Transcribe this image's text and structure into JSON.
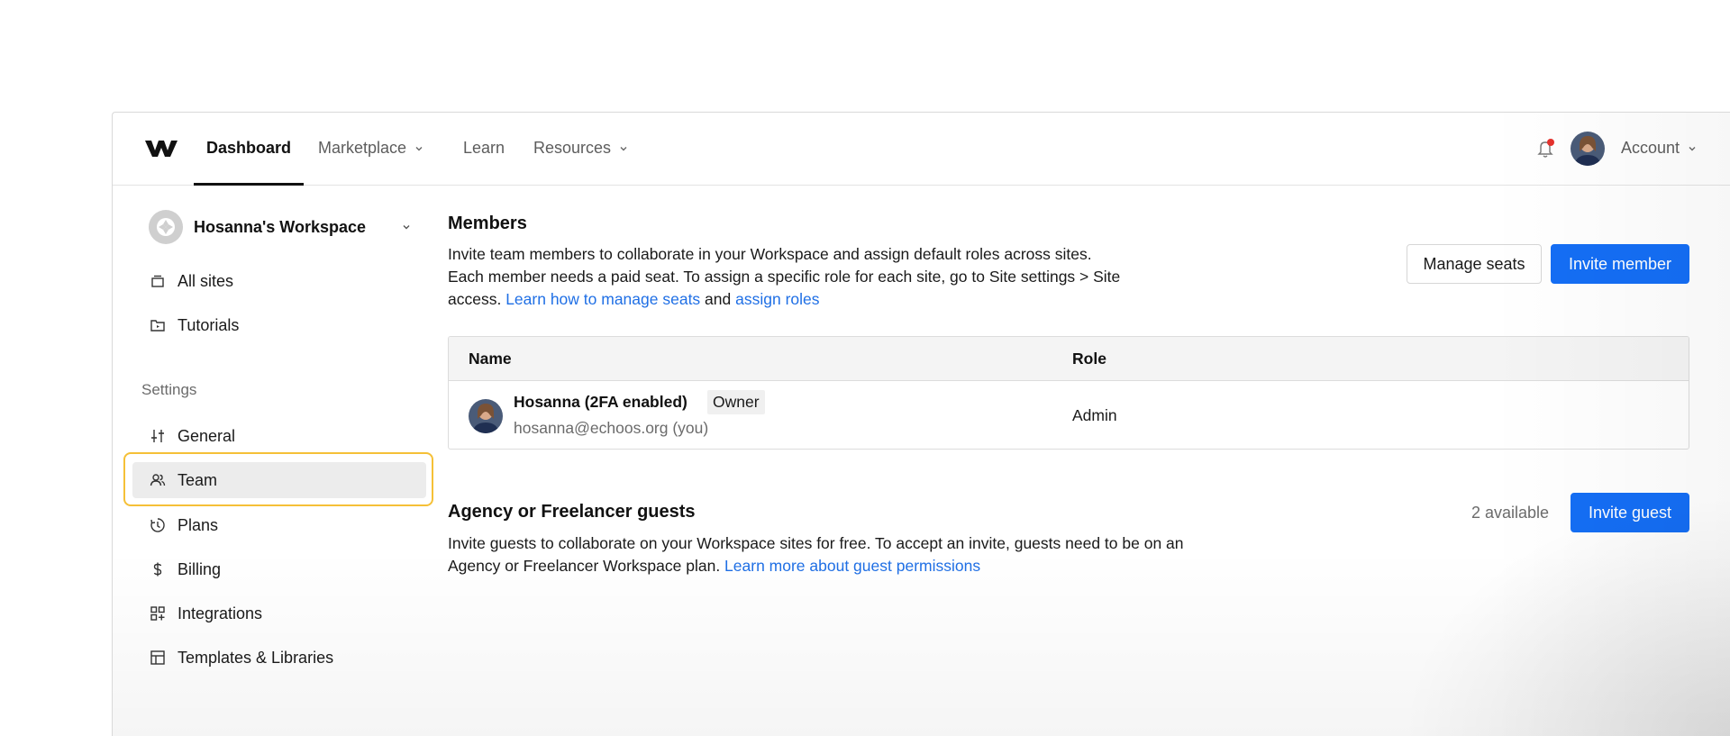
{
  "nav": {
    "items": [
      {
        "label": "Dashboard",
        "active": true,
        "dropdown": false
      },
      {
        "label": "Marketplace",
        "active": false,
        "dropdown": true
      },
      {
        "label": "Learn",
        "active": false,
        "dropdown": false
      },
      {
        "label": "Resources",
        "active": false,
        "dropdown": true
      }
    ],
    "account_label": "Account",
    "notification_dot_color": "#e5322d"
  },
  "sidebar": {
    "workspace_name": "Hosanna's Workspace",
    "top_items": [
      {
        "label": "All sites",
        "icon": "folder-stack-icon"
      },
      {
        "label": "Tutorials",
        "icon": "video-folder-icon"
      }
    ],
    "settings_heading": "Settings",
    "settings_items": [
      {
        "label": "General",
        "icon": "sliders-icon"
      },
      {
        "label": "Team",
        "icon": "users-icon",
        "selected": true
      },
      {
        "label": "Plans",
        "icon": "plan-cycle-icon"
      },
      {
        "label": "Billing",
        "icon": "dollar-icon"
      },
      {
        "label": "Integrations",
        "icon": "apps-grid-icon"
      },
      {
        "label": "Templates & Libraries",
        "icon": "layout-icon"
      }
    ]
  },
  "members": {
    "title": "Members",
    "desc_1": "Invite team members to collaborate in your Workspace and assign default roles across sites.",
    "desc_2": "Each member needs a paid seat. To assign a specific role for each site, go to Site settings > Site",
    "desc_3": "access. ",
    "link_seats": "Learn how to manage seats",
    "desc_and": " and ",
    "link_roles": "assign roles",
    "manage_seats_label": "Manage seats",
    "invite_member_label": "Invite member",
    "table": {
      "columns": [
        "Name",
        "Role"
      ],
      "rows": [
        {
          "name": "Hosanna (2FA enabled)",
          "badge": "Owner",
          "email": "hosanna@echoos.org (you)",
          "role": "Admin"
        }
      ]
    }
  },
  "guests": {
    "title": "Agency or Freelancer guests",
    "available": "2 available",
    "invite_guest_label": "Invite guest",
    "desc_1": "Invite guests to collaborate on your Workspace sites for free. To accept an invite, guests need to be on an",
    "desc_2": "Agency or Freelancer Workspace plan. ",
    "link_permissions": "Learn more about guest permissions"
  },
  "colors": {
    "primary": "#146ef5",
    "link": "#1f6fe5",
    "focus_ring": "#f5c037"
  }
}
